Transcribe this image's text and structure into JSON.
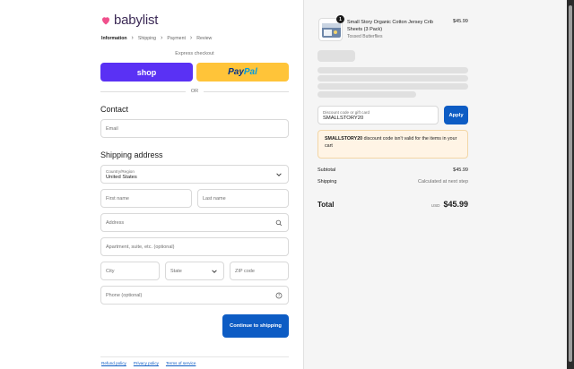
{
  "brand": {
    "name": "babylist",
    "heart_color": "#f0508c",
    "text_color": "#3d2b57"
  },
  "breadcrumb": [
    {
      "label": "Information",
      "active": true
    },
    {
      "label": "Shipping",
      "active": false
    },
    {
      "label": "Payment",
      "active": false
    },
    {
      "label": "Review",
      "active": false
    }
  ],
  "express": {
    "label": "Express checkout",
    "shop_label": "shop",
    "paypal_part1": "Pay",
    "paypal_part2": "Pal",
    "or_label": "OR"
  },
  "contact": {
    "heading": "Contact",
    "email_placeholder": "Email"
  },
  "shipping": {
    "heading": "Shipping address",
    "country_label": "Country/Region",
    "country_value": "United States",
    "first_name": "First name",
    "last_name": "Last name",
    "address": "Address",
    "apartment": "Apartment, suite, etc. (optional)",
    "city": "City",
    "state": "State",
    "zip": "ZIP code",
    "phone": "Phone (optional)"
  },
  "continue_label": "Continue to shipping",
  "footer_links": [
    "Refund policy",
    "Privacy policy",
    "Terms of service"
  ],
  "order": {
    "item": {
      "quantity": "1",
      "title": "Small Story Organic Cotton Jersey Crib Sheets (3 Pack)",
      "variant": "Tossed Butterflies",
      "price": "$45.99"
    },
    "discount": {
      "label": "Discount code or gift card",
      "value": "SMALLSTORY20",
      "apply_label": "Apply"
    },
    "warning": {
      "code": "SMALLSTORY20",
      "message": " discount code isn't valid for the items in your cart"
    },
    "subtotal_label": "Subtotal",
    "subtotal_value": "$45.99",
    "shipping_label": "Shipping",
    "shipping_value": "Calculated at next step",
    "total_label": "Total",
    "currency": "USD",
    "total_value": "$45.99"
  },
  "colors": {
    "primary": "#0d5cc4",
    "shop_pay": "#5a31f4",
    "paypal": "#ffc439",
    "warning_bg": "#fff4e5"
  }
}
